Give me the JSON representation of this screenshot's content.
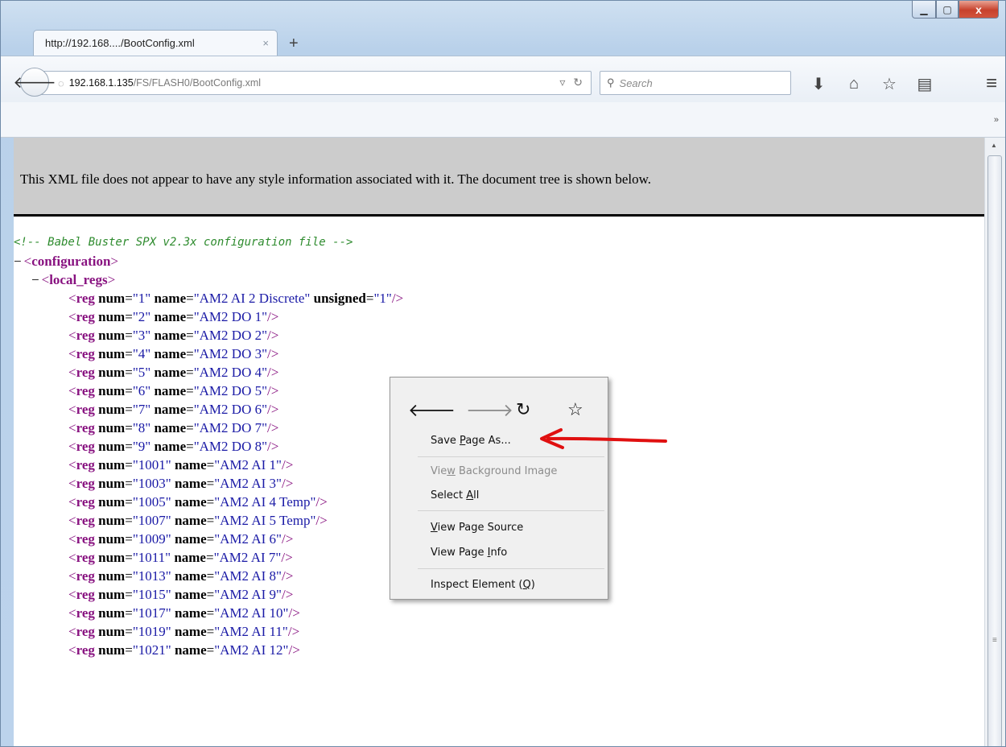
{
  "window": {
    "minimize_icon": "minimize-icon",
    "maximize_icon": "maximize-icon",
    "close_label": "x"
  },
  "tab": {
    "title": "http://192.168..../BootConfig.xml",
    "close": "×",
    "new_tab": "+"
  },
  "navbar": {
    "url_host": "192.168.1.135",
    "url_path": "/FS/FLASH0/BootConfig.xml",
    "search_placeholder": "Search"
  },
  "content": {
    "info": "This XML file does not appear to have any style information associated with it. The document tree is shown below.",
    "comment": "<!-- Babel Buster SPX v2.3x configuration file -->",
    "root_tag": "configuration",
    "section_tag": "local_regs",
    "regs": [
      {
        "num": "1",
        "name": "AM2 AI 2 Discrete",
        "unsigned": "1"
      },
      {
        "num": "2",
        "name": "AM2 DO 1"
      },
      {
        "num": "3",
        "name": "AM2 DO 2"
      },
      {
        "num": "4",
        "name": "AM2 DO 3"
      },
      {
        "num": "5",
        "name": "AM2 DO 4"
      },
      {
        "num": "6",
        "name": "AM2 DO 5"
      },
      {
        "num": "7",
        "name": "AM2 DO 6"
      },
      {
        "num": "8",
        "name": "AM2 DO 7"
      },
      {
        "num": "9",
        "name": "AM2 DO 8"
      },
      {
        "num": "1001",
        "name": "AM2 AI 1"
      },
      {
        "num": "1003",
        "name": "AM2 AI 3"
      },
      {
        "num": "1005",
        "name": "AM2 AI 4 Temp"
      },
      {
        "num": "1007",
        "name": "AM2 AI 5 Temp"
      },
      {
        "num": "1009",
        "name": "AM2 AI 6"
      },
      {
        "num": "1011",
        "name": "AM2 AI 7"
      },
      {
        "num": "1013",
        "name": "AM2 AI 8"
      },
      {
        "num": "1015",
        "name": "AM2 AI 9"
      },
      {
        "num": "1017",
        "name": "AM2 AI 10"
      },
      {
        "num": "1019",
        "name": "AM2 AI 11"
      },
      {
        "num": "1021",
        "name": "AM2 AI 12"
      }
    ]
  },
  "context_menu": {
    "items": [
      {
        "id": "save-page-as",
        "pre": "Save ",
        "ul": "P",
        "post": "age As...",
        "disabled": false
      },
      {
        "id": "view-background-image",
        "pre": "Vie",
        "ul": "w",
        "post": " Background Image",
        "disabled": true
      },
      {
        "id": "select-all",
        "pre": "Select ",
        "ul": "A",
        "post": "ll",
        "disabled": false
      },
      {
        "id": "view-page-source",
        "pre": "",
        "ul": "V",
        "post": "iew Page Source",
        "disabled": false
      },
      {
        "id": "view-page-info",
        "pre": "View Page ",
        "ul": "I",
        "post": "nfo",
        "disabled": false
      },
      {
        "id": "inspect-element",
        "pre": "Inspect Element (",
        "ul": "Q",
        "post": ")",
        "disabled": false
      }
    ]
  },
  "colors": {
    "tag": "#881280",
    "attr_value": "#1a1aa6",
    "comment": "#2e8b2e",
    "annotation_arrow": "#e01010"
  }
}
